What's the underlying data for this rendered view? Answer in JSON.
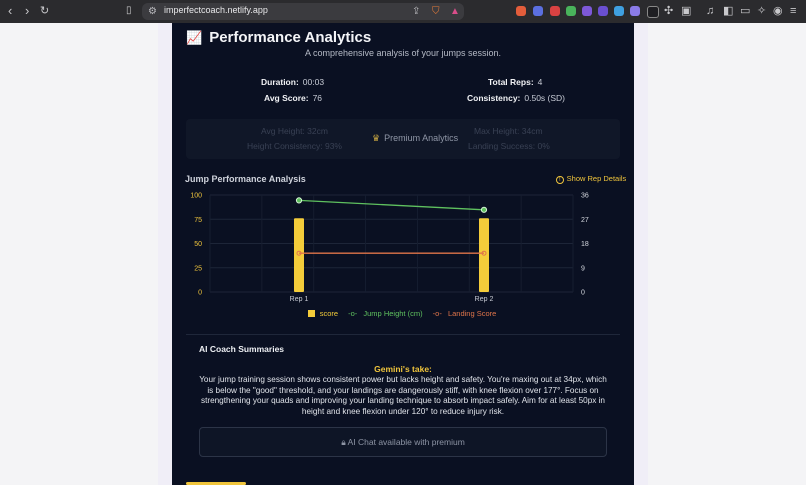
{
  "browser": {
    "url": "imperfectcoach.netlify.app"
  },
  "header": {
    "title": "Performance Analytics",
    "subtitle": "A comprehensive analysis of your jumps session."
  },
  "stats": {
    "duration_label": "Duration:",
    "duration_value": "00:03",
    "total_reps_label": "Total Reps:",
    "total_reps_value": "4",
    "avg_score_label": "Avg Score:",
    "avg_score_value": "76",
    "consistency_label": "Consistency:",
    "consistency_value": "0.50s (SD)"
  },
  "premium": {
    "label": "Premium Analytics",
    "avg_height_label": "Avg Height:",
    "avg_height_value": "32cm",
    "max_height_label": "Max Height:",
    "max_height_value": "34cm",
    "height_consistency_label": "Height Consistency:",
    "height_consistency_value": "93%",
    "landing_success_label": "Landing Success:",
    "landing_success_value": "0%"
  },
  "chart_section": {
    "title": "Jump Performance Analysis",
    "details_link": "Show Rep Details"
  },
  "chart_data": {
    "type": "bar",
    "categories": [
      "Rep 1",
      "Rep 2"
    ],
    "series": [
      {
        "name": "score",
        "type": "bar",
        "axis": "left",
        "values": [
          76,
          76
        ],
        "color": "#f4cc3a"
      },
      {
        "name": "Jump Height (cm)",
        "type": "line",
        "axis": "right",
        "values": [
          34,
          30.5
        ],
        "color": "#5fc15f"
      },
      {
        "name": "Landing Score",
        "type": "line",
        "axis": "left",
        "values": [
          40,
          40
        ],
        "color": "#e0754a"
      }
    ],
    "y_left": {
      "min": 0,
      "max": 100,
      "ticks": [
        "0",
        "25",
        "50",
        "75",
        "100"
      ]
    },
    "y_right": {
      "min": 0,
      "max": 36,
      "ticks": [
        "0",
        "9",
        "18",
        "27",
        "36"
      ]
    },
    "grid": true,
    "legend_position": "bottom"
  },
  "ai": {
    "title": "AI Coach Summaries",
    "source_heading": "Gemini's take:",
    "summary": "Your jump training session shows consistent power but lacks height and safety. You're maxing out at 34px, which is below the \"good\" threshold, and your landings are dangerously stiff, with knee flexion over 177°. Focus on strengthening your quads and improving your landing technique to absorb impact safely. Aim for at least 50px in height and knee flexion under 120° to reduce injury risk.",
    "chat_label": "AI Chat available with premium"
  }
}
